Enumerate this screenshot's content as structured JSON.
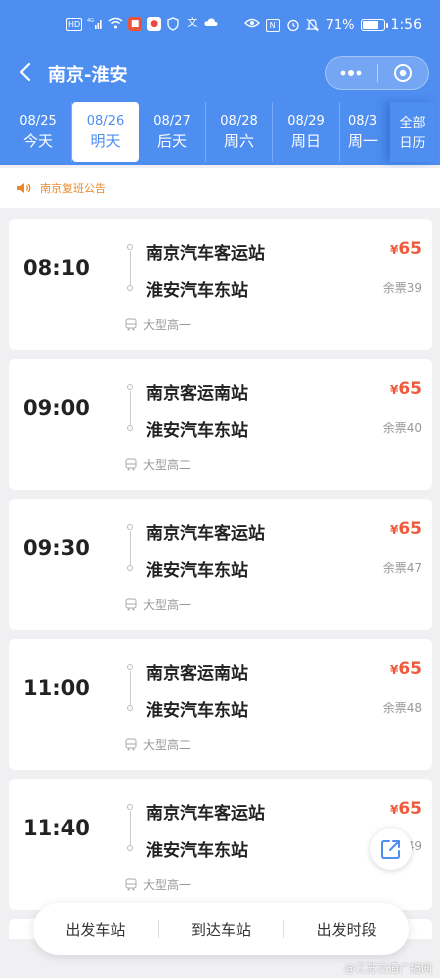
{
  "status_bar": {
    "left_icons": [
      "HD",
      "4G",
      "wifi",
      "app-red",
      "app-white",
      "app-shield",
      "translate",
      "cloud"
    ],
    "battery_percent": "71%",
    "battery_level": 0.71,
    "time": "1:56"
  },
  "header": {
    "title": "南京-淮安"
  },
  "date_tabs": [
    {
      "date": "08/25",
      "weekday": "今天",
      "active": false
    },
    {
      "date": "08/26",
      "weekday": "明天",
      "active": true
    },
    {
      "date": "08/27",
      "weekday": "后天",
      "active": false
    },
    {
      "date": "08/28",
      "weekday": "周六",
      "active": false
    },
    {
      "date": "08/29",
      "weekday": "周日",
      "active": false
    },
    {
      "date": "08/3",
      "weekday": "周一",
      "active": false
    }
  ],
  "all_calendar": {
    "line1": "全部",
    "line2": "日历"
  },
  "notice": {
    "text": "南京复班公告"
  },
  "trips": [
    {
      "time": "08:10",
      "from": "南京汽车客运站",
      "to": "淮安汽车东站",
      "price_symbol": "¥",
      "price": "65",
      "seats": "余票39",
      "bus": "大型高一"
    },
    {
      "time": "09:00",
      "from": "南京客运南站",
      "to": "淮安汽车东站",
      "price_symbol": "¥",
      "price": "65",
      "seats": "余票40",
      "bus": "大型高二"
    },
    {
      "time": "09:30",
      "from": "南京汽车客运站",
      "to": "淮安汽车东站",
      "price_symbol": "¥",
      "price": "65",
      "seats": "余票47",
      "bus": "大型高一"
    },
    {
      "time": "11:00",
      "from": "南京客运南站",
      "to": "淮安汽车东站",
      "price_symbol": "¥",
      "price": "65",
      "seats": "余票48",
      "bus": "大型高二"
    },
    {
      "time": "11:40",
      "from": "南京汽车客运站",
      "to": "淮安汽车东站",
      "price_symbol": "¥",
      "price": "65",
      "seats": "49",
      "bus": "大型高一"
    }
  ],
  "filters": [
    "出发车站",
    "到达车站",
    "出发时段"
  ],
  "watermark": "@江苏交通广播网",
  "colors": {
    "primary": "#4e8ef0",
    "price": "#ee5a3c",
    "notice": "#e88a2a"
  }
}
